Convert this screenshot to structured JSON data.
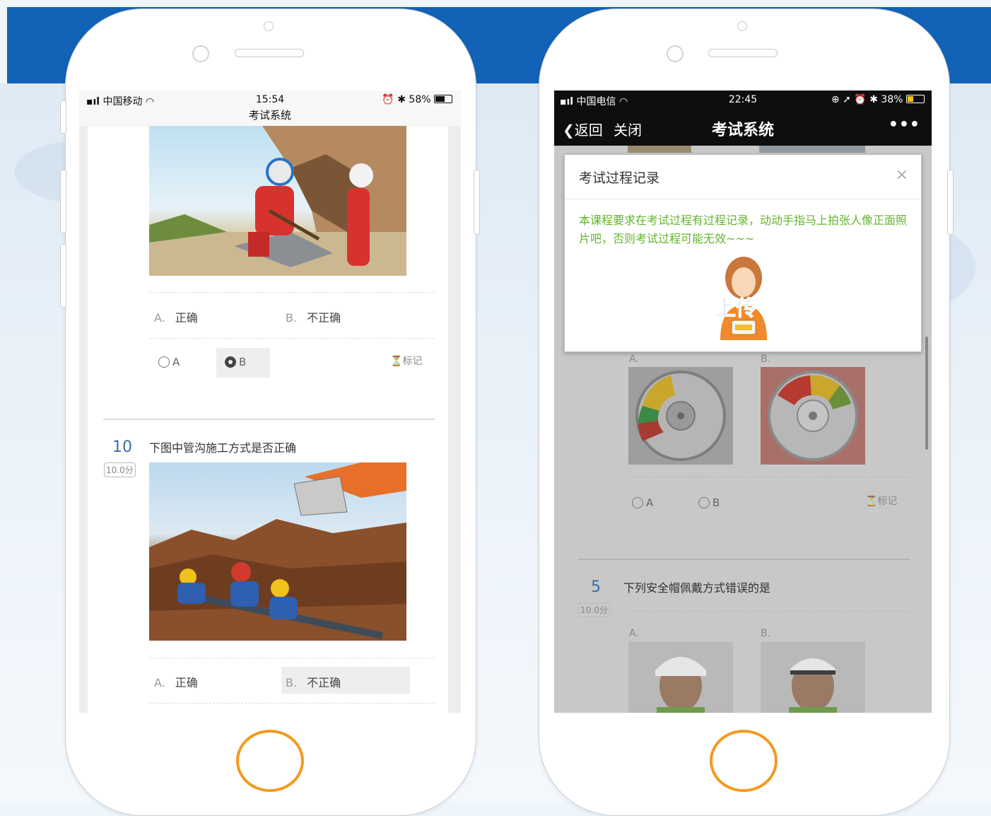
{
  "left_phone": {
    "status": {
      "carrier": "中国移动",
      "time": "15:54",
      "battery": "58%",
      "title": "考试系统"
    },
    "q9": {
      "option_a": {
        "letter": "A.",
        "text": "正确"
      },
      "option_b": {
        "letter": "B.",
        "text": "不正确"
      },
      "radio_a": "A",
      "radio_b": "B",
      "selected": "B",
      "mark": "标记"
    },
    "q10": {
      "number": "10",
      "score": "10.0分",
      "text": "下图中管沟施工方式是否正确",
      "option_a": {
        "letter": "A.",
        "text": "正确"
      },
      "option_b": {
        "letter": "B.",
        "text": "不正确"
      }
    }
  },
  "right_phone": {
    "status": {
      "carrier": "中国电信",
      "time": "22:45",
      "battery": "38%"
    },
    "nav": {
      "back": "返回",
      "close": "关闭",
      "title": "考试系统",
      "more": "•••"
    },
    "modal": {
      "title": "考试过程记录",
      "close": "×",
      "message": "本课程要求在考试过程有过程记录，动动手指马上拍张人像正面照片吧，否则考试过程可能无效~~~",
      "upload_label": "上传"
    },
    "q4": {
      "label_a": "A.",
      "label_b": "B.",
      "radio_a": "A",
      "radio_b": "B",
      "mark": "标记"
    },
    "q5": {
      "number": "5",
      "score": "10.0分",
      "text": "下列安全帽佩戴方式错误的是",
      "label_a": "A.",
      "label_b": "B."
    }
  }
}
